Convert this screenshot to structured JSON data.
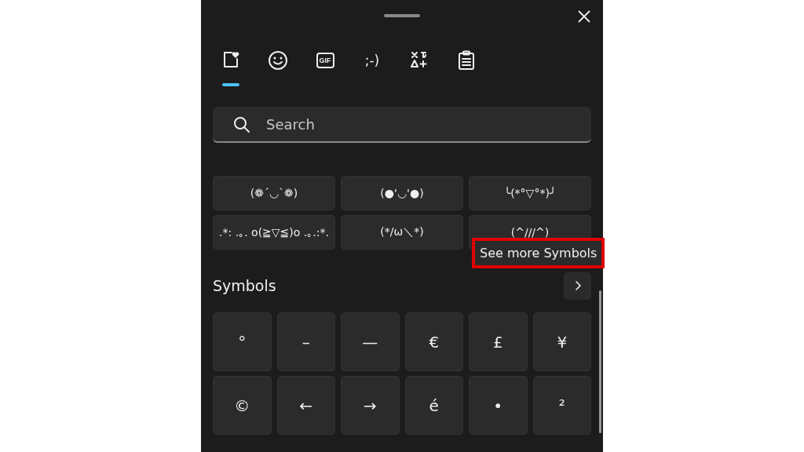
{
  "tabs": [
    {
      "kind": "favorites",
      "selected": true
    },
    {
      "kind": "emoji",
      "selected": false
    },
    {
      "kind": "gif",
      "label": "GIF",
      "selected": false
    },
    {
      "kind": "kaomoji",
      "label": ";-)",
      "selected": false
    },
    {
      "kind": "symbols",
      "selected": false
    },
    {
      "kind": "clipboard",
      "selected": false
    }
  ],
  "search": {
    "placeholder": "Search"
  },
  "kaomoji": [
    "(❁´◡`❁)",
    "(●'◡'●)",
    "╰(*°▽°*)╯",
    ".*: .｡. o(≧▽≦)o .｡.:*.",
    "(*/ω＼*)",
    "(^///^)"
  ],
  "tooltip": {
    "text": "See more Symbols",
    "highlighted": true
  },
  "symbols_section": {
    "title": "Symbols",
    "items": [
      "°",
      "–",
      "—",
      "€",
      "£",
      "¥",
      "©",
      "←",
      "→",
      "é",
      "•",
      "²"
    ]
  }
}
